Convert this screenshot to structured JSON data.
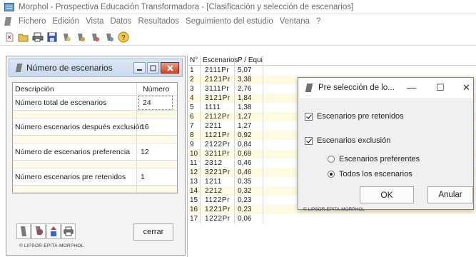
{
  "window": {
    "title": "Morphol  -  Prospectiva Educación Transformadora - [Clasificación y selección de escenarios]"
  },
  "menu": [
    "Fichero",
    "Edición",
    "Vista",
    "Datos",
    "Resultados",
    "Seguimiento del estudio",
    "Ventana",
    "?"
  ],
  "toolbar": {
    "icons": [
      "new-icon",
      "open-icon",
      "print-icon",
      "save-icon",
      "tool-icon-1",
      "tool-icon-2",
      "tool-icon-3",
      "tool-icon-4",
      "help-icon"
    ]
  },
  "left_panel": {
    "title": "Número de escenarios",
    "header": {
      "description": "Descripción",
      "number": "Número"
    },
    "rows": [
      {
        "description": "Número total de escenarios",
        "value": "24"
      },
      {
        "description": "Número escenarios después exclusión",
        "value": "16"
      },
      {
        "description": "Número de escenarios preferencia",
        "value": "12"
      },
      {
        "description": "Número escenarios pre retenidos",
        "value": "1"
      }
    ],
    "close_label": "cerrar",
    "footer": "© LIPSOR-EPITA-MORPHOL"
  },
  "grid": {
    "headers": {
      "n": "N°",
      "escenarios": "Escenarios",
      "p": "P / Equi"
    },
    "rows": [
      {
        "n": "1",
        "e": "2111Pr",
        "p": "5,07"
      },
      {
        "n": "2",
        "e": "2121Pr",
        "p": "3,38"
      },
      {
        "n": "3",
        "e": "3111Pr",
        "p": "2,76"
      },
      {
        "n": "4",
        "e": "3121Pr",
        "p": "1,84"
      },
      {
        "n": "5",
        "e": "1111",
        "p": "1,38"
      },
      {
        "n": "6",
        "e": "2112Pr",
        "p": "1,27"
      },
      {
        "n": "7",
        "e": "2211",
        "p": "1,27"
      },
      {
        "n": "8",
        "e": "1121Pr",
        "p": "0,92"
      },
      {
        "n": "9",
        "e": "2122Pr",
        "p": "0,84"
      },
      {
        "n": "10",
        "e": "3211Pr",
        "p": "0,69"
      },
      {
        "n": "11",
        "e": "2312",
        "p": "0,46"
      },
      {
        "n": "12",
        "e": "3221Pr",
        "p": "0,46"
      },
      {
        "n": "13",
        "e": "1211",
        "p": "0,35"
      },
      {
        "n": "14",
        "e": "2212",
        "p": "0,32"
      },
      {
        "n": "15",
        "e": "1122Pr",
        "p": "0,23"
      },
      {
        "n": "16",
        "e": "1221Pr",
        "p": "0,23"
      },
      {
        "n": "17",
        "e": "1222Pr",
        "p": "0,06"
      }
    ]
  },
  "dialog": {
    "title": "Pre selección de lo...",
    "minimize": "—",
    "maximize": "☐",
    "close": "✕",
    "check_pre_retenidos": "Escenarios pre retenidos",
    "check_exclusion": "Escenarios exclusión",
    "radio_preferentes": "Escenarios preferentes",
    "radio_todos": "Todos los escenarios",
    "ok": "OK",
    "cancel": "Anular",
    "footer": "© LIPSOR-EPITA-MORPHOL"
  }
}
